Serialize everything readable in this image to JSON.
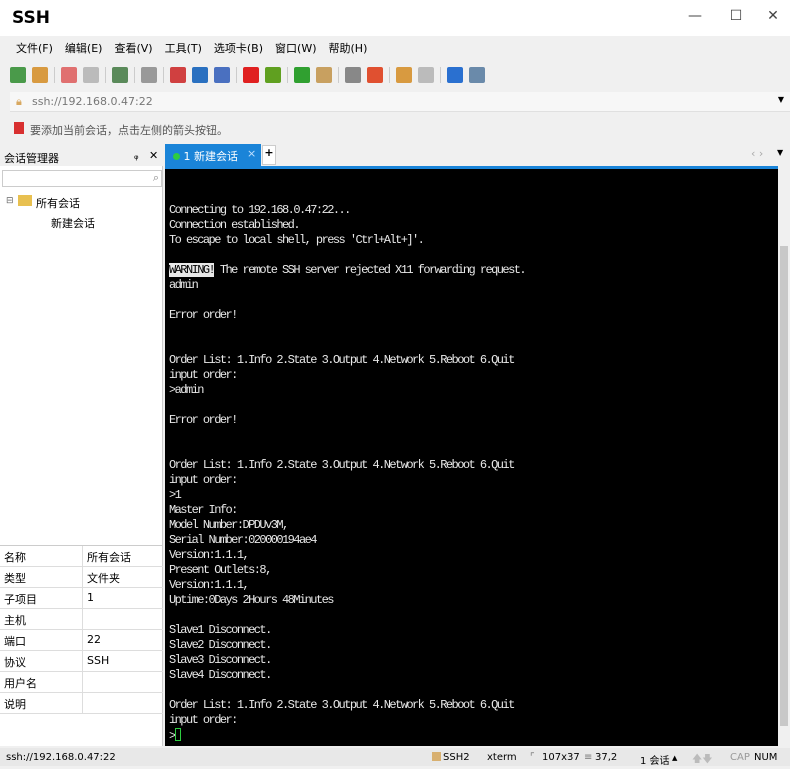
{
  "window": {
    "title": "SSH",
    "minimize": "—",
    "maximize": "☐",
    "close": "✕"
  },
  "menu": [
    "文件(F)",
    "编辑(E)",
    "查看(V)",
    "工具(T)",
    "选项卡(B)",
    "窗口(W)",
    "帮助(H)"
  ],
  "toolbar_icons": [
    {
      "name": "new-session-icon",
      "color": "#4a9a4a"
    },
    {
      "name": "open-folder-icon",
      "color": "#d89a40"
    },
    {
      "name": "disconnect-icon",
      "color": "#e07070"
    },
    {
      "name": "reconnect-icon",
      "color": "#bbbbbb"
    },
    {
      "name": "session-properties-icon",
      "color": "#5a8a5a"
    },
    {
      "name": "find-icon",
      "color": "#999999"
    },
    {
      "name": "layout-icon",
      "color": "#d04040"
    },
    {
      "name": "globe-icon",
      "color": "#2a70c0"
    },
    {
      "name": "font-icon",
      "color": "#4a70c0"
    },
    {
      "name": "xshell-icon",
      "color": "#e02020"
    },
    {
      "name": "xftp-icon",
      "color": "#60a020"
    },
    {
      "name": "fullscreen-icon",
      "color": "#30a030"
    },
    {
      "name": "lock-icon",
      "color": "#c8a060"
    },
    {
      "name": "keyboard-icon",
      "color": "#888888"
    },
    {
      "name": "highlight-icon",
      "color": "#e05030"
    },
    {
      "name": "new-tab-icon",
      "color": "#d89a40"
    },
    {
      "name": "panel-icon",
      "color": "#bbbbbb"
    },
    {
      "name": "help-icon",
      "color": "#2a70d0"
    },
    {
      "name": "chat-icon",
      "color": "#6a8aaa"
    }
  ],
  "address": "ssh://192.168.0.47:22",
  "hint": "要添加当前会话，点击左侧的箭头按钮。",
  "session_manager": {
    "title": "会话管理器",
    "pin": "ᵩ",
    "close": "✕",
    "tree_root": "所有会话",
    "tree_child": "新建会话"
  },
  "properties": [
    [
      "名称",
      "所有会话"
    ],
    [
      "类型",
      "文件夹"
    ],
    [
      "子项目",
      "1"
    ],
    [
      "主机",
      ""
    ],
    [
      "端口",
      "22"
    ],
    [
      "协议",
      "SSH"
    ],
    [
      "用户名",
      ""
    ],
    [
      "说明",
      ""
    ]
  ],
  "tab": {
    "label": "1 新建会话",
    "close": "×",
    "add": "+"
  },
  "terminal": {
    "lines_before_warning": [
      "",
      "Connecting to 192.168.0.47:22...",
      "Connection established.",
      "To escape to local shell, press 'Ctrl+Alt+]'.",
      ""
    ],
    "warning_tag": "WARNING!",
    "warning_text": " The remote SSH server rejected X11 forwarding request.",
    "lines_after": [
      "admin",
      "",
      "Error order!",
      "",
      "",
      "Order List: 1.Info 2.State 3.Output 4.Network 5.Reboot 6.Quit",
      "input order:",
      ">admin",
      "",
      "Error order!",
      "",
      "",
      "Order List: 1.Info 2.State 3.Output 4.Network 5.Reboot 6.Quit",
      "input order:",
      ">1",
      "Master Info:",
      "Model Number:DPDUv3M,",
      "Serial Number:020000194ae4",
      "Version:1.1.1,",
      "Present Outlets:8,",
      "Version:1.1.1,",
      "Uptime:0Days 2Hours 48Minutes",
      "",
      "Slave1 Disconnect.",
      "Slave2 Disconnect.",
      "Slave3 Disconnect.",
      "Slave4 Disconnect.",
      "",
      "Order List: 1.Info 2.State 3.Output 4.Network 5.Reboot 6.Quit",
      "input order:"
    ],
    "prompt": ">"
  },
  "status": {
    "address": "ssh://192.168.0.47:22",
    "protocol": "SSH2",
    "term": "xterm",
    "size": "107x37",
    "cursor": "37,2",
    "sessions": "1 会话",
    "cap": "CAP",
    "num": "NUM"
  },
  "colors": {
    "accent": "#1a84d8",
    "terminal_bg": "#000000",
    "cursor": "#2ecc40"
  }
}
